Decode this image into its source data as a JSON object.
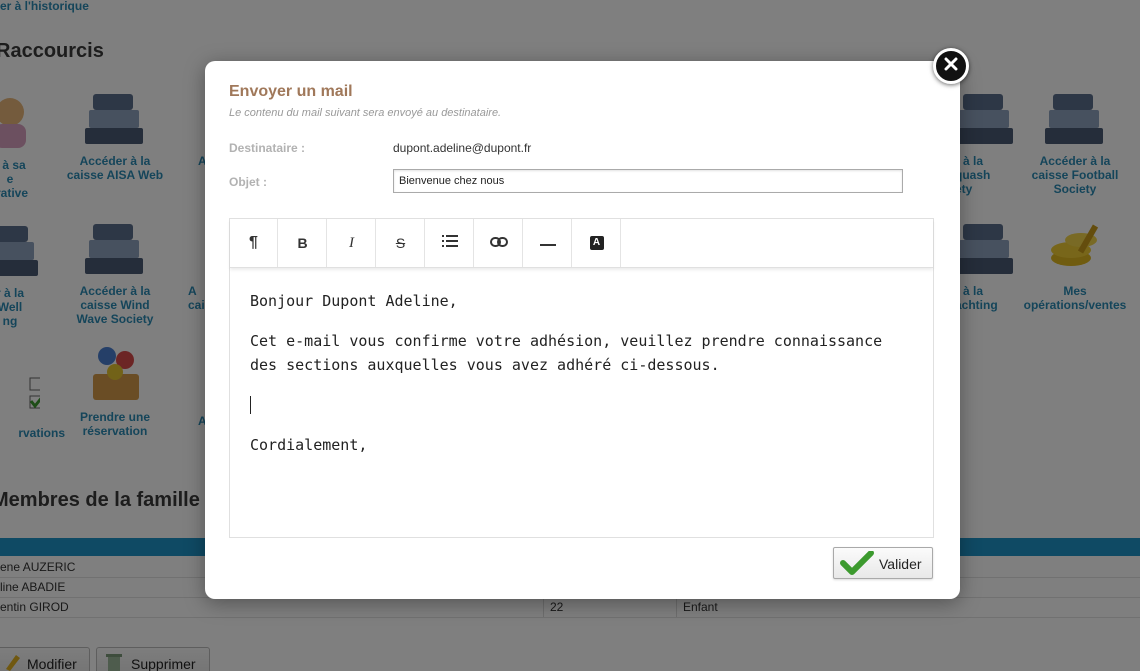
{
  "background": {
    "back_link": "er à l'historique",
    "shortcuts_title": "Raccourcis",
    "family_title": "Membres de la famille",
    "tiles": [
      {
        "label": "r à sa\ne\ntrative"
      },
      {
        "label": "Accéder à la\ncaisse AISA Web"
      },
      {
        "label": "A"
      },
      {
        "label": "r à la\nquash\nety"
      },
      {
        "label": "Accéder à la\ncaisse Football\nSociety"
      },
      {
        "label": "r à la\n Well\nng"
      },
      {
        "label": "Accéder à la\ncaisse Wind\nWave Society"
      },
      {
        "label": "A\ncai"
      },
      {
        "label": "r à la\nachting"
      },
      {
        "label": "Mes\nopérations/ventes"
      },
      {
        "label": "rvations"
      },
      {
        "label": "Prendre une\nréservation"
      },
      {
        "label": "A"
      }
    ],
    "family_rows": [
      {
        "name": "ene AUZERIC",
        "age": "",
        "role": ""
      },
      {
        "name": "line ABADIE",
        "age": "",
        "role": ""
      },
      {
        "name": "entin GIROD",
        "age": "22",
        "role": "Enfant"
      }
    ],
    "buttons": {
      "modify": "Modifier",
      "delete": "Supprimer"
    }
  },
  "modal": {
    "title": "Envoyer un mail",
    "subtitle": "Le contenu du mail suivant sera envoyé au destinataire.",
    "recipient_label": "Destinataire :",
    "recipient_value": "dupont.adeline@dupont.fr",
    "subject_label": "Objet :",
    "subject_value": "Bienvenue chez nous",
    "toolbar": [
      {
        "name": "paragraph-icon",
        "glyph": "¶"
      },
      {
        "name": "bold-icon",
        "glyph": "B"
      },
      {
        "name": "italic-icon",
        "glyph": "I"
      },
      {
        "name": "strikethrough-icon",
        "glyph": "S"
      },
      {
        "name": "list-icon",
        "glyph": ""
      },
      {
        "name": "link-icon",
        "glyph": ""
      },
      {
        "name": "horizontal-rule-icon",
        "glyph": ""
      },
      {
        "name": "text-color-icon",
        "glyph": "A"
      }
    ],
    "body": {
      "greeting": "Bonjour Dupont Adeline,",
      "paragraph": "Cet e-mail vous confirme votre adhésion, veuillez prendre connaissance des sections auxquelles vous avez adhéré ci-dessous.",
      "closing": "Cordialement,"
    },
    "submit_label": "Valider"
  },
  "colors": {
    "title": "#a0785a",
    "link": "#2a8bb5",
    "family_bar": "#1f95c9",
    "check": "#3c9a2e"
  }
}
